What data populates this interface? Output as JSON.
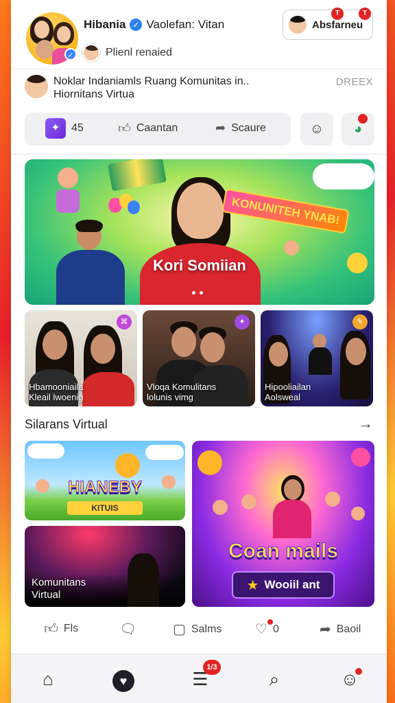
{
  "header": {
    "title_name": "Hibania",
    "title_rest": "Vaolefan: Vitan",
    "subtitle": "Plienl renaied",
    "action_button_label": "Absfarneu",
    "action_badge_1": "T",
    "action_badge_2": "T"
  },
  "community": {
    "text": "Noklar Indaniamls Ruang Komunitas in.. Hiornitans Virtua",
    "tag": "DREEX"
  },
  "stats": {
    "count": "45",
    "like_label": "Caantan",
    "share_label": "Scaure"
  },
  "hero": {
    "title": "Kori Somiian",
    "sign": "KONUNITEH YNAB!"
  },
  "cards": [
    {
      "label_1": "Hbamooniaila",
      "label_2": "Kleail lwoenig"
    },
    {
      "label_1": "Vloqa Komulitans",
      "label_2": "lolunis vimg"
    },
    {
      "label_1": "Hipooliailan",
      "label_2": "Aolsweal"
    }
  ],
  "section": {
    "title": "Silarans Virtual"
  },
  "tiles": {
    "top_left_title": "HIANEBY",
    "top_left_sub": "KITUIS",
    "bottom_left_label": "Komunitans Virtual",
    "right_title": "Coan mails",
    "right_button": "Wooiil ant"
  },
  "actions": {
    "like": "Fls",
    "comment": "",
    "save": "Salms",
    "love_count": "0",
    "share": "Baoil"
  },
  "nav": {
    "badge": "1/3"
  },
  "colors": {
    "accent_red": "#e02424",
    "verify_blue": "#2f80ed",
    "hero_green": "#36c27a",
    "purple": "#6d28d9"
  }
}
